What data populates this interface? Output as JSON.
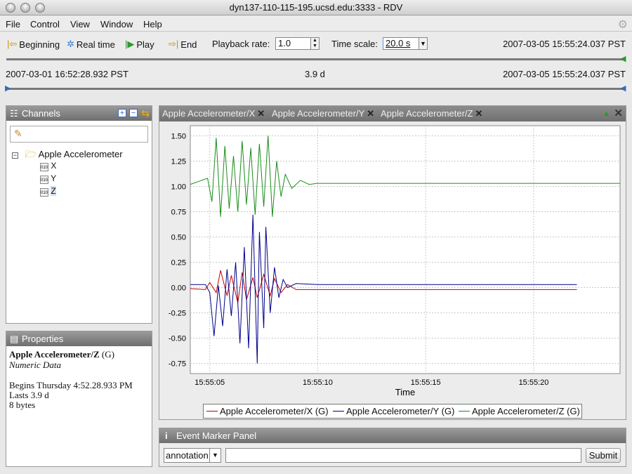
{
  "window": {
    "title": "dyn137-110-115-195.ucsd.edu:3333 - RDV"
  },
  "menu": [
    "File",
    "Control",
    "View",
    "Window",
    "Help"
  ],
  "toolbar": {
    "beginning": "Beginning",
    "realtime": "Real time",
    "play": "Play",
    "end": "End",
    "playback_label": "Playback rate:",
    "playback_value": "1.0",
    "timescale_label": "Time scale:",
    "timescale_value": "20.0 s",
    "current_time": "2007-03-05 15:55:24.037 PST",
    "start_time": "2007-03-01 16:52:28.932 PST",
    "duration": "3.9 d",
    "end_time": "2007-03-05 15:55:24.037 PST"
  },
  "channels": {
    "title": "Channels",
    "root": "Apple Accelerometer",
    "items": [
      "X",
      "Y",
      "Z"
    ],
    "selected": "Z"
  },
  "properties": {
    "title": "Properties",
    "name": "Apple Accelerometer/Z",
    "unit": "(G)",
    "type": "Numeric Data",
    "begins": "Begins Thursday 4:52.28.933 PM",
    "lasts": "Lasts 3.9 d",
    "size": "8 bytes"
  },
  "tabs": [
    "Apple Accelerometer/X",
    "Apple Accelerometer/Y",
    "Apple Accelerometer/Z"
  ],
  "chart_data": {
    "type": "line",
    "xlabel": "Time",
    "x_ticks": [
      "15:55:05",
      "15:55:10",
      "15:55:15",
      "15:55:20"
    ],
    "x_tick_seconds": [
      5,
      10,
      15,
      20
    ],
    "xlim": [
      4.1,
      24.0
    ],
    "ylim": [
      -0.85,
      1.6
    ],
    "y_ticks": [
      1.5,
      1.25,
      1.0,
      0.75,
      0.5,
      0.25,
      0.0,
      -0.25,
      -0.5,
      -0.75
    ],
    "grid": true,
    "legend": "bottom",
    "series": [
      {
        "name": "Apple Accelerometer/X (G)",
        "color": "#c00000",
        "x": [
          4.1,
          4.8,
          5.0,
          5.3,
          5.5,
          5.8,
          6.0,
          6.3,
          6.5,
          6.7,
          7.0,
          7.2,
          7.5,
          7.8,
          8.0,
          8.3,
          8.6,
          9.0,
          10.0,
          12.0,
          15.0,
          18.0,
          21.0,
          22.0
        ],
        "y": [
          -0.01,
          -0.02,
          0.05,
          -0.05,
          0.17,
          -0.08,
          0.12,
          -0.15,
          0.15,
          -0.12,
          0.1,
          -0.1,
          0.13,
          -0.08,
          0.09,
          -0.05,
          0.03,
          -0.02,
          -0.02,
          -0.02,
          -0.02,
          -0.02,
          -0.02,
          -0.02
        ]
      },
      {
        "name": "Apple Accelerometer/Y (G)",
        "color": "#00008b",
        "x": [
          4.1,
          4.8,
          5.0,
          5.2,
          5.4,
          5.6,
          5.8,
          6.0,
          6.2,
          6.4,
          6.6,
          6.8,
          7.0,
          7.2,
          7.3,
          7.5,
          7.6,
          7.8,
          8.0,
          8.2,
          8.4,
          8.6,
          9.0,
          10.0,
          12.0,
          15.0,
          18.0,
          21.0,
          22.0
        ],
        "y": [
          0.03,
          0.03,
          -0.05,
          -0.48,
          0.02,
          -0.38,
          0.18,
          -0.28,
          0.25,
          -0.55,
          0.4,
          -0.6,
          0.72,
          -0.75,
          0.55,
          -0.4,
          0.6,
          -0.25,
          0.2,
          -0.1,
          0.08,
          0.0,
          0.04,
          0.03,
          0.03,
          0.03,
          0.03,
          0.03,
          0.03
        ]
      },
      {
        "name": "Apple Accelerometer/Z (G)",
        "color": "#1a8c1a",
        "x": [
          4.1,
          4.5,
          4.9,
          5.1,
          5.3,
          5.5,
          5.7,
          5.9,
          6.1,
          6.3,
          6.5,
          6.7,
          6.9,
          7.1,
          7.3,
          7.5,
          7.7,
          7.9,
          8.1,
          8.3,
          8.5,
          8.8,
          9.2,
          9.6,
          10.0,
          12.0,
          15.0,
          18.0,
          21.0,
          24.0
        ],
        "y": [
          1.02,
          1.05,
          1.08,
          0.85,
          1.48,
          0.7,
          1.4,
          0.78,
          1.3,
          0.75,
          1.45,
          0.82,
          1.38,
          0.72,
          1.42,
          0.8,
          1.5,
          0.7,
          1.25,
          0.9,
          1.12,
          0.98,
          1.06,
          1.02,
          1.03,
          1.03,
          1.03,
          1.03,
          1.03,
          1.03
        ]
      }
    ]
  },
  "event_panel": {
    "title": "Event Marker Panel",
    "select_value": "annotation",
    "input_value": "",
    "submit": "Submit"
  }
}
